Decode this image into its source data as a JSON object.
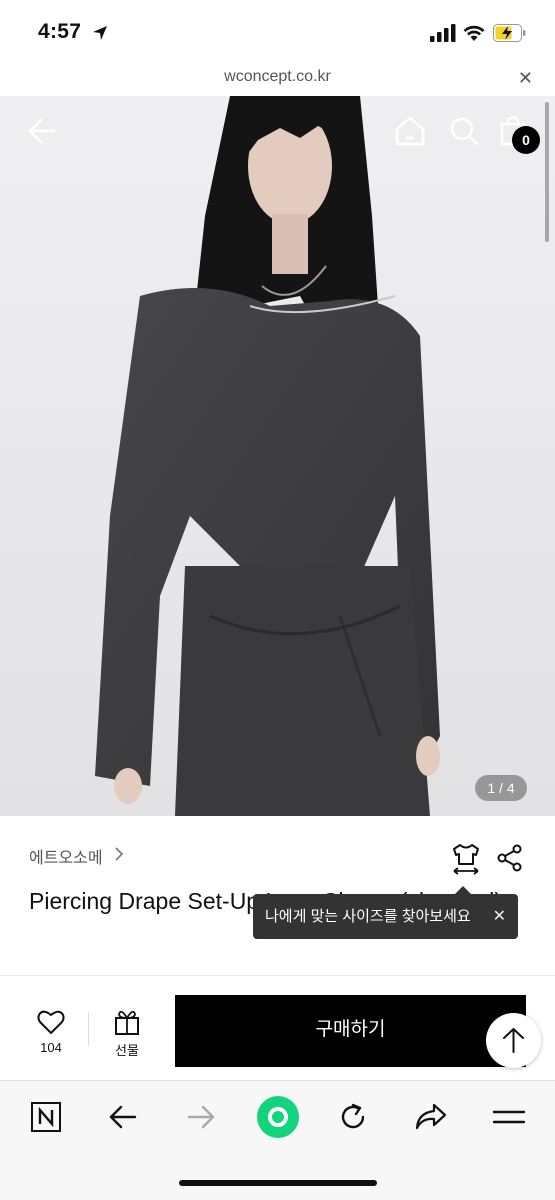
{
  "status_bar": {
    "time": "4:57"
  },
  "url_bar": {
    "url": "wconcept.co.kr",
    "close_label": "✕"
  },
  "gallery": {
    "page_indicator": "1 / 4",
    "cart_count": "0"
  },
  "product": {
    "brand": "에트오소메",
    "title": "Piercing Drape Set-Up Long Sleeve (charcoal)"
  },
  "tooltip": {
    "text": "나에게 맞는 사이즈를 찾아보세요",
    "close_label": "✕"
  },
  "purchase_bar": {
    "like_count": "104",
    "gift_label": "선물",
    "buy_label": "구매하기"
  },
  "colors": {
    "accent_green": "#12d47a",
    "buy_button": "#000000",
    "tooltip_bg": "#333333"
  },
  "icons": [
    "back-arrow-icon",
    "home-icon",
    "search-icon",
    "cart-icon",
    "size-guide-icon",
    "share-icon",
    "heart-icon",
    "gift-icon",
    "scroll-top-icon",
    "naver-n-icon",
    "browser-back-icon",
    "browser-forward-icon",
    "green-dot-icon",
    "reload-icon",
    "share-arrow-icon",
    "menu-icon"
  ]
}
